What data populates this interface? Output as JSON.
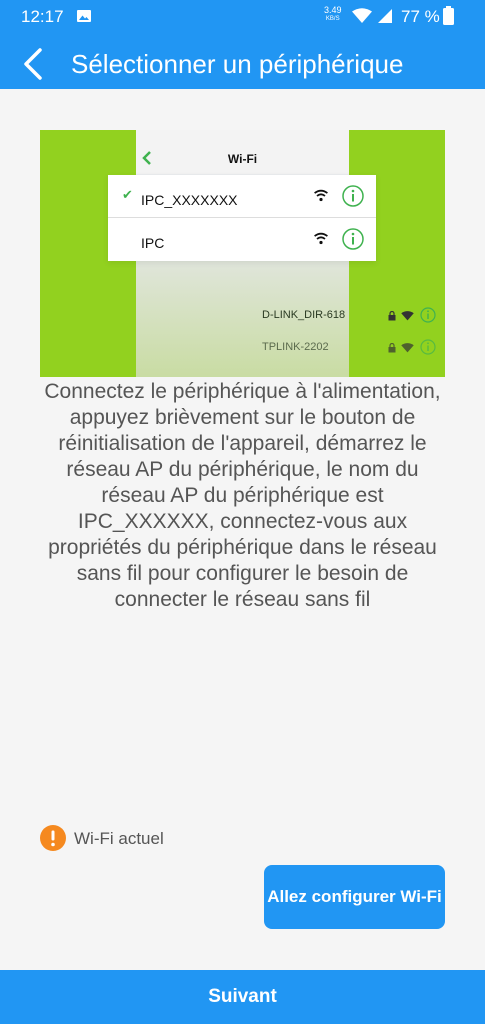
{
  "status_bar": {
    "time": "12:17",
    "speed_value": "3.49",
    "speed_unit": "KB/S",
    "battery": "77 %"
  },
  "header": {
    "title": "Sélectionner un périphérique"
  },
  "illustration": {
    "screen_title": "Wi-Fi",
    "networks": [
      {
        "name": "IPC_XXXXXXX",
        "selected": true
      },
      {
        "name": "IPC",
        "selected": false
      }
    ],
    "other_networks": [
      {
        "name": "D-LINK_DIR-618"
      },
      {
        "name": "TPLINK-2202"
      }
    ]
  },
  "description": "Connectez le périphérique à l'alimentation, appuyez brièvement sur le bouton de réinitialisation de l'appareil, démarrez le réseau AP du périphérique, le nom du réseau AP du périphérique est IPC_XXXXXX, connectez-vous aux propriétés du périphérique dans le réseau sans fil pour configurer le besoin de connecter le réseau sans fil",
  "current_wifi": {
    "label": "Wi-Fi actuel"
  },
  "buttons": {
    "configure_wifi": "Allez configurer Wi-Fi",
    "next": "Suivant"
  },
  "colors": {
    "primary": "#2196f3",
    "illustration_bg": "#92d11f",
    "warning": "#f5891f",
    "check": "#3fb24f"
  }
}
